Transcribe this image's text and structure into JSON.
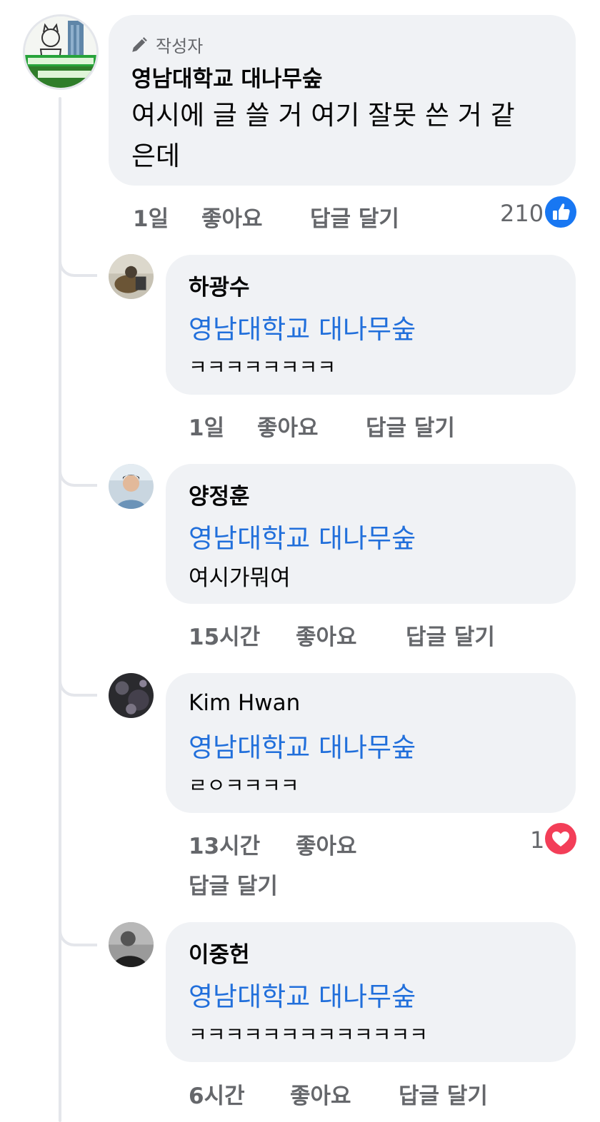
{
  "main_comment": {
    "author_badge": "작성자",
    "author": "영남대학교 대나무숲",
    "text": "여시에 글 쓸 거 여기 잘못 쓴 거 같은데",
    "time": "1일",
    "like_label": "좋아요",
    "reply_label": "답글 달기",
    "reaction_count": "210",
    "reaction_icon": "like-icon",
    "reaction_color": "#1877f2"
  },
  "replies": [
    {
      "author": "하광수",
      "mention": "영남대학교 대나무숲",
      "text": "ㅋㅋㅋㅋㅋㅋㅋㅋ",
      "time": "1일",
      "like_label": "좋아요",
      "reply_label": "답글 달기"
    },
    {
      "author": "양정훈",
      "mention": "영남대학교 대나무숲",
      "text": "여시가뭐여",
      "time": "15시간",
      "like_label": "좋아요",
      "reply_label": "답글 달기"
    },
    {
      "author": "Kim Hwan",
      "mention": "영남대학교 대나무숲",
      "text": "ㄹㅇㅋㅋㅋㅋ",
      "time": "13시간",
      "like_label": "좋아요",
      "reply_label": "답글 달기",
      "reaction_count": "1",
      "reaction_icon": "heart-icon",
      "reaction_color": "#f33e58"
    },
    {
      "author": "이중헌",
      "mention": "영남대학교 대나무숲",
      "text": "ㅋㅋㅋㅋㅋㅋㅋㅋㅋㅋㅋㅋㅋ",
      "time": "6시간",
      "like_label": "좋아요",
      "reply_label": "답글 달기"
    }
  ]
}
